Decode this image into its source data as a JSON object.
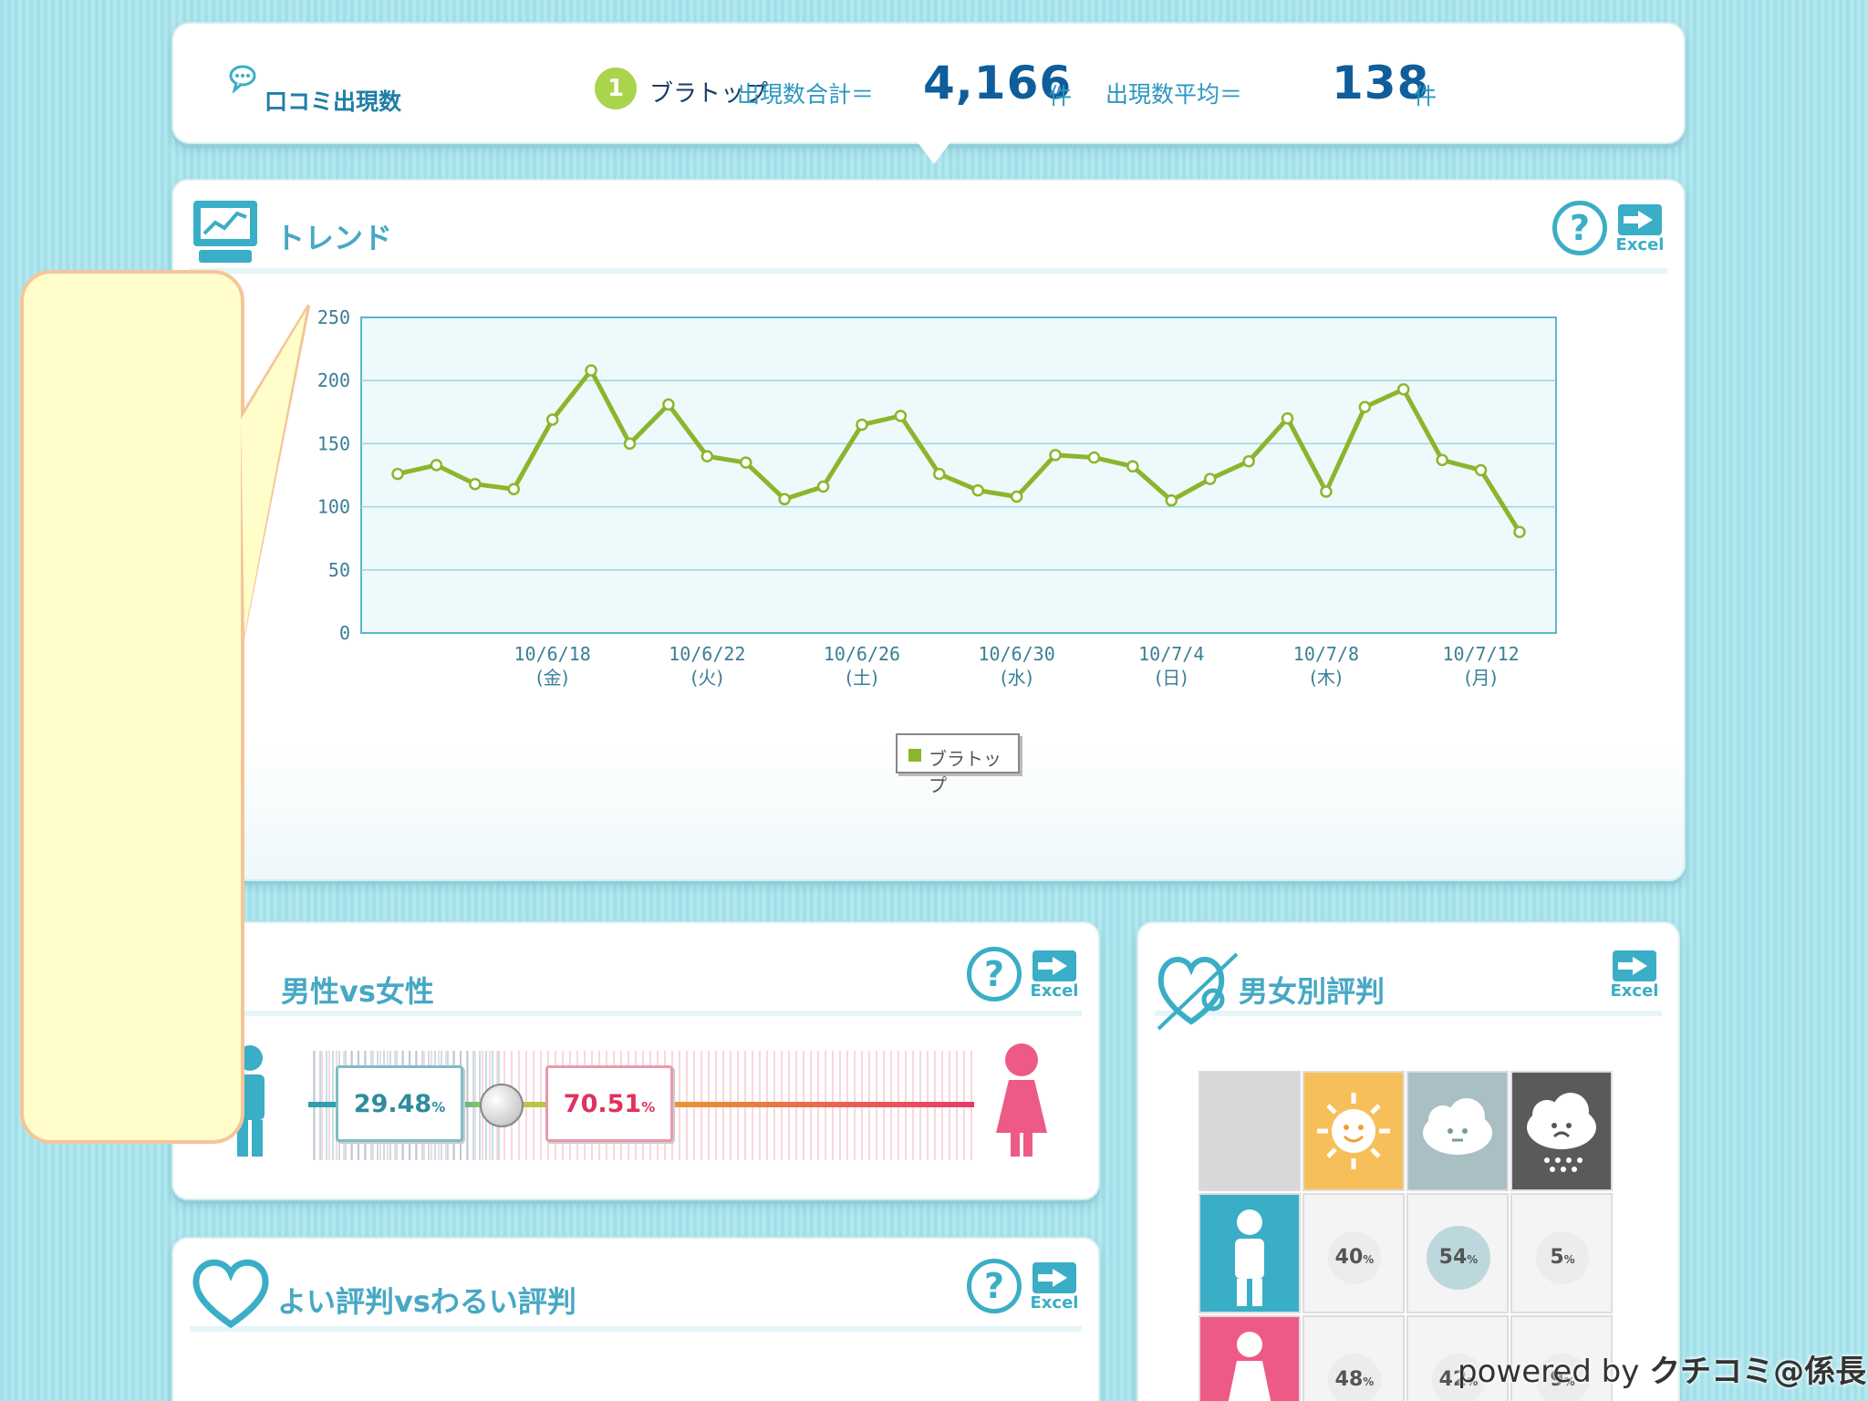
{
  "summary": {
    "title": "口コミ出現数",
    "rank": "1",
    "target_name": "ブラトップ",
    "total_label": "出現数合計＝",
    "total_value": "4,166",
    "total_unit": "件",
    "avg_label": "出現数平均＝",
    "avg_value": "138",
    "avg_unit": "件"
  },
  "trend": {
    "title": "トレンド",
    "help_icon": "?",
    "excel_label": "Excel"
  },
  "chart_data": {
    "type": "line",
    "title": "",
    "xlabel": "",
    "ylabel": "",
    "ylim": [
      0,
      250
    ],
    "yticks": [
      "0",
      "50",
      "100",
      "150",
      "200",
      "250"
    ],
    "grid": true,
    "legend_placement": "bottom-center",
    "x_tick_labels": [
      {
        "date": "10/6/18",
        "day": "(金)",
        "index": 4
      },
      {
        "date": "10/6/22",
        "day": "(火)",
        "index": 8
      },
      {
        "date": "10/6/26",
        "day": "(土)",
        "index": 12
      },
      {
        "date": "10/6/30",
        "day": "(水)",
        "index": 16
      },
      {
        "date": "10/7/4",
        "day": "(日)",
        "index": 20
      },
      {
        "date": "10/7/8",
        "day": "(木)",
        "index": 24
      },
      {
        "date": "10/7/12",
        "day": "(月)",
        "index": 28
      }
    ],
    "series": [
      {
        "name": "ブラトップ",
        "color": "#8ab62c",
        "values": [
          126,
          133,
          118,
          114,
          169,
          208,
          150,
          181,
          140,
          135,
          106,
          116,
          165,
          172,
          126,
          113,
          108,
          141,
          139,
          132,
          105,
          122,
          136,
          170,
          112,
          179,
          193,
          137,
          129,
          80
        ]
      }
    ]
  },
  "gender": {
    "title": "男性vs女性",
    "male_pct": "29.48",
    "female_pct": "70.51",
    "pct_unit": "%",
    "male_ratio": 0.2948
  },
  "reputation": {
    "title": "よい評判vsわるい評判"
  },
  "gender_rep": {
    "title": "男女別評判",
    "excel_label": "Excel",
    "male_row": [
      "40",
      "54",
      "5"
    ],
    "female_row": [
      "48",
      "42",
      "9"
    ],
    "pct_unit": "%"
  },
  "footer": {
    "powered_by": "powered by",
    "brand": "クチコミ@係長"
  }
}
